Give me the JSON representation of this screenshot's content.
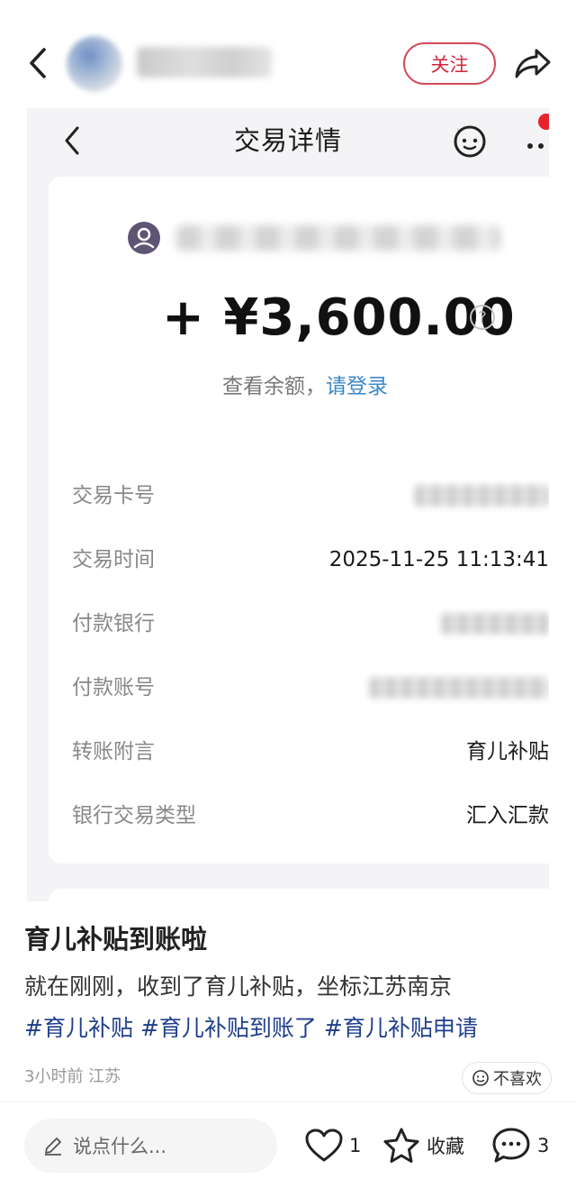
{
  "header": {
    "follow_label": "关注"
  },
  "screenshot": {
    "title": "交易详情",
    "amount": "+ ¥3,600.00",
    "balance_label": "查看余额，",
    "login_link": "请登录",
    "rows": [
      {
        "label": "交易卡号",
        "value": ""
      },
      {
        "label": "交易时间",
        "value": "2025-11-25 11:13:41"
      },
      {
        "label": "付款银行",
        "value": ""
      },
      {
        "label": "付款账号",
        "value": ""
      },
      {
        "label": "转账附言",
        "value": "育儿补贴"
      },
      {
        "label": "银行交易类型",
        "value": "汇入汇款"
      }
    ]
  },
  "post": {
    "title": "育儿补贴到账啦",
    "body": "就在刚刚，收到了育儿补贴，坐标江苏南京",
    "tags": [
      "#育儿补贴",
      "#育儿补贴到账了",
      "#育儿补贴申请"
    ],
    "meta": "3小时前 江苏",
    "dislike_label": "不喜欢"
  },
  "bottom_bar": {
    "comment_placeholder": "说点什么...",
    "like_count": "1",
    "collect_label": "收藏",
    "comment_count": "3"
  },
  "colors": {
    "follow_red": "#d02a3e",
    "link_blue": "#3b87c9",
    "tag_blue": "#1f3f8c",
    "badge_red": "#e8222c"
  },
  "icons": [
    "back-arrow-icon",
    "share-icon",
    "bot-face-icon",
    "more-icon",
    "user-icon",
    "question-icon",
    "smile-icon",
    "pencil-icon",
    "heart-icon",
    "star-icon",
    "comment-bubble-icon"
  ]
}
